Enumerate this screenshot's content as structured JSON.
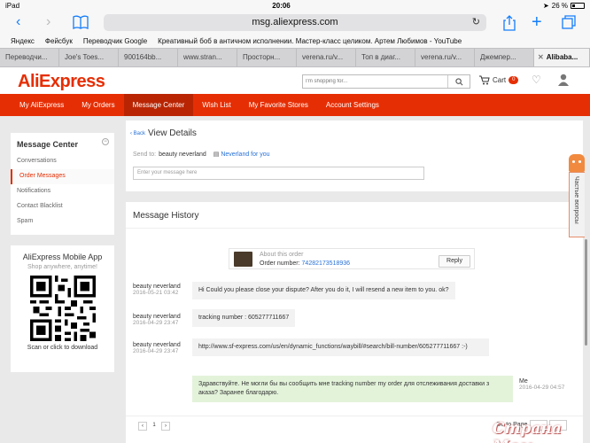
{
  "status": {
    "device": "iPad",
    "time": "20:06",
    "battery": "26 %"
  },
  "safari": {
    "url": "msg.aliexpress.com"
  },
  "bookmarks": [
    "Яндекс",
    "Фейсбук",
    "Переводчик Google",
    "Креативный боб в античном исполнении. Мастер-класс целиком. Артем Любимов - YouTube"
  ],
  "tabs": [
    "Переводчи...",
    "Joe's Toes...",
    "900164bb...",
    "www.stran...",
    "Просторн...",
    "verena.ru/v...",
    "Топ в диаг...",
    "verena.ru/v...",
    "Джемпер...",
    "Alibaba..."
  ],
  "header": {
    "logo": "AliExpress",
    "search_placeholder": "I'm shopping for...",
    "cart_label": "Cart",
    "cart_count": "0"
  },
  "nav": [
    "My AliExpress",
    "My Orders",
    "Message Center",
    "Wish List",
    "My Favorite Stores",
    "Account Settings"
  ],
  "sidebar": {
    "title": "Message Center",
    "items": [
      "Conversations",
      "Order Messages",
      "Notifications",
      "Contact Blacklist",
      "Spam"
    ]
  },
  "app": {
    "title": "AliExpress Mobile App",
    "subtitle": "Shop anywhere, anytime!",
    "scan": "Scan or click to download"
  },
  "detail": {
    "back": "Back",
    "title": "View Details",
    "send_to_label": "Send to:",
    "send_to_name": "beauty neverland",
    "store": "Neverland for you",
    "placeholder": "Enter your message here"
  },
  "history": {
    "title": "Message History",
    "order_about": "About this order",
    "order_label": "Order number:",
    "order_number": "74282173518936",
    "reply": "Reply",
    "messages": [
      {
        "sender": "beauty neverland",
        "date": "2016-05-21 03:42",
        "text": "Hi Could you please close your dispute? After you do it, I will resend a new item to you. ok?"
      },
      {
        "sender": "beauty neverland",
        "date": "2016-04-29 23:47",
        "text": "tracking number : 605277711667"
      },
      {
        "sender": "beauty neverland",
        "date": "2016-04-29 23:47",
        "text": "http://www.sf-express.com/us/en/dynamic_functions/waybill/#search/bill-number/605277711667 :-)"
      }
    ],
    "me": {
      "sender": "Me",
      "date": "2016-04-29 04:57",
      "text": "Здравствуйте. Не могли бы вы сообщить мне tracking number my order для отслеживания доставки з аказа? Заранее благодарю."
    }
  },
  "pager": {
    "prev": "‹",
    "page": "1",
    "next": "›",
    "goto": "Go to Page"
  },
  "help": {
    "text": "Частые вопросы"
  },
  "watermark": "Страна Мам"
}
